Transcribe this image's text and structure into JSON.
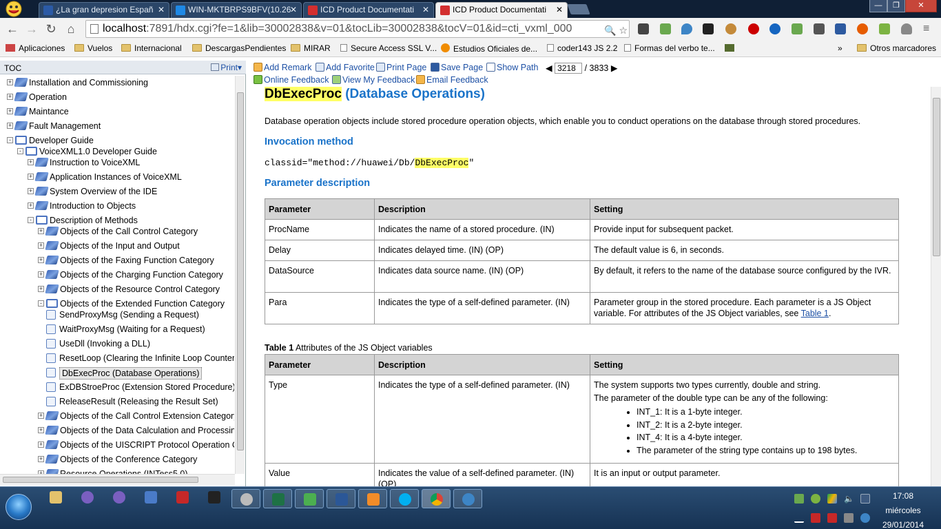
{
  "browser": {
    "tabs": [
      {
        "title": "¿La gran depresion Españ",
        "favicon_color": "#2b5aa6"
      },
      {
        "title": "WIN-MKTBRPS9BFV(10.26",
        "favicon_color": "#1e88e5"
      },
      {
        "title": "ICD Product Documentati",
        "favicon_color": "#d32f2f"
      },
      {
        "title": "ICD Product Documentati",
        "favicon_color": "#d32f2f"
      }
    ],
    "address": {
      "host": "localhost",
      "path": ":7891/hdx.cgi?fe=1&lib=30002838&v=01&tocLib=30002838&tocV=01&id=cti_vxml_000"
    },
    "bookmarks": [
      {
        "label": "Aplicaciones",
        "icon": "apps-grid-icon"
      },
      {
        "label": "Vuelos",
        "icon": "folder-icon"
      },
      {
        "label": "Internacional",
        "icon": "folder-icon"
      },
      {
        "label": "DescargasPendientes",
        "icon": "folder-icon"
      },
      {
        "label": "MIRAR",
        "icon": "folder-icon"
      },
      {
        "label": "Secure Access SSL V...",
        "icon": "page-icon"
      },
      {
        "label": "Estudios Oficiales de...",
        "icon": "orange-circle-icon"
      },
      {
        "label": "coder143 JS 2.2",
        "icon": "page-icon"
      },
      {
        "label": "Formas del verbo te...",
        "icon": "page-icon"
      },
      {
        "label": "»",
        "icon": "chevron-icon"
      },
      {
        "label": "Otros marcadores",
        "icon": "folder-icon"
      }
    ]
  },
  "toc": {
    "title": "TOC",
    "print_label": "Print",
    "nodes": [
      {
        "label": "Installation and Commissioning"
      },
      {
        "label": "Operation"
      },
      {
        "label": "Maintance"
      },
      {
        "label": "Fault Management"
      },
      {
        "label": "Developer Guide"
      },
      {
        "label": "VoiceXML1.0 Developer Guide"
      },
      {
        "label": "Instruction to VoiceXML"
      },
      {
        "label": "Application Instances of VoiceXML"
      },
      {
        "label": "System Overview of the IDE"
      },
      {
        "label": "Introduction to Objects"
      },
      {
        "label": "Description of Methods"
      },
      {
        "label": "Objects of the Call Control Category"
      },
      {
        "label": "Objects of the Input and Output"
      },
      {
        "label": "Objects of the Faxing Function Category"
      },
      {
        "label": "Objects of the Charging Function Category"
      },
      {
        "label": "Objects of the Resource Control Category"
      },
      {
        "label": "Objects of the Extended Function Category"
      },
      {
        "label": "SendProxyMsg (Sending a Request)"
      },
      {
        "label": "WaitProxyMsg (Waiting for a Request)"
      },
      {
        "label": "UseDll (Invoking a DLL)"
      },
      {
        "label": "ResetLoop (Clearing the Infinite Loop Counter"
      },
      {
        "label": "DbExecProc (Database Operations)"
      },
      {
        "label": "ExDBStroeProc (Extension Stored Procedure)"
      },
      {
        "label": "ReleaseResult (Releasing the Result Set)"
      },
      {
        "label": "Objects of the Call Control Extension Category"
      },
      {
        "label": "Objects of the Data Calculation and Processin"
      },
      {
        "label": "Objects of the UISCRIPT Protocol Operation C"
      },
      {
        "label": "Objects of the Conference Category"
      },
      {
        "label": "Resource Operations (INTess5.0)"
      }
    ]
  },
  "doc_toolbar": {
    "add_remark": "Add Remark",
    "add_favorite": "Add Favorite",
    "print_page": "Print Page",
    "save_page": "Save Page",
    "show_path": "Show Path",
    "page_current": "3218",
    "page_total": "/ 3833",
    "online_feedback": "Online Feedback",
    "view_feedback": "View My Feedback",
    "email_feedback": "Email Feedback"
  },
  "doc": {
    "title_highlight": "DbExecProc",
    "title_rest": " (Database Operations)",
    "intro": "Database operation objects include stored procedure operation objects, which enable you to conduct operations on the database through stored procedures.",
    "invocation_heading": "Invocation method",
    "code_prefix": "classid=\"method://huawei/Db/",
    "code_highlight": "DbExecProc",
    "code_suffix": "\"",
    "param_heading": "Parameter description",
    "table1": {
      "headers": [
        "Parameter",
        "Description",
        "Setting"
      ],
      "rows": [
        [
          "ProcName",
          "Indicates the name of a stored procedure. (IN)",
          "Provide input for subsequent packet."
        ],
        [
          "Delay",
          "Indicates delayed time. (IN) (OP)",
          "The default value is 6, in seconds."
        ],
        [
          "DataSource",
          "Indicates data source name. (IN) (OP)",
          "By default, it refers to the name of the database source configured by the IVR."
        ],
        [
          "Para",
          "Indicates the type of a self-defined parameter. (IN)",
          "Parameter group in the stored procedure. Each parameter is a JS Object variable. For attributes of the JS Object variables, see "
        ]
      ],
      "link_text": "Table 1",
      "link_suffix": "."
    },
    "table2_caption_bold": "Table 1",
    "table2_caption": " Attributes of the JS Object variables",
    "table2": {
      "headers": [
        "Parameter",
        "Description",
        "Setting"
      ],
      "type_param": "Type",
      "type_desc": "Indicates the type of a self-defined parameter. (IN)",
      "type_setting_1": "The system supports two types currently, double and string.",
      "type_setting_2": "The parameter of the double type can be any of the following:",
      "bullets": [
        "INT_1: It is a 1-byte integer.",
        "INT_2: It is a 2-byte integer.",
        "INT_4: It is a 4-byte integer.",
        "The parameter of the string type contains up to 198 bytes."
      ],
      "value_param": "Value",
      "value_desc": "Indicates the value of a self-defined parameter. (IN) (OP)",
      "value_setting": "It is an input or output parameter."
    }
  },
  "taskbar": {
    "time": "17:08",
    "day": "miércoles",
    "date": "29/01/2014"
  }
}
